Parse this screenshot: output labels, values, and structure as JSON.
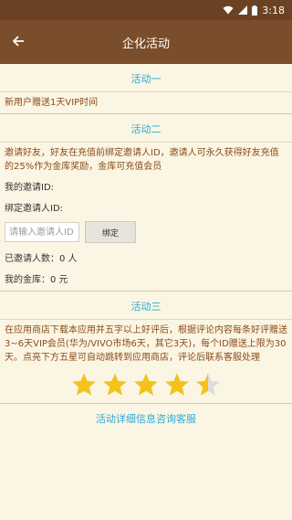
{
  "status_bar": {
    "time": "3:18"
  },
  "app_bar": {
    "title": "企化活动"
  },
  "section1": {
    "title": "活动一",
    "text": "新用户赠送1天VIP时间"
  },
  "section2": {
    "title": "活动二",
    "description": "邀请好友，好友在充值前绑定邀请人ID，邀请人可永久获得好友充值的25%作为金库奖励，金库可充值会员",
    "my_code_label": "我的邀请ID:",
    "bind_label": "绑定邀请人ID:",
    "input_placeholder": "请输入邀请人ID",
    "bind_button": "绑定",
    "invited_count": "已邀请人数：0 人",
    "vault": "我的金库：0 元"
  },
  "section3": {
    "title": "活动三",
    "description": "在应用商店下载本应用并五字以上好评后，根据评论内容每条好评赠送3~6天VIP会员(华为/VIVO市场6天，其它3天)，每个ID赠送上限为30天。点亮下方五星可自动跳转到应用商店，评论后联系客服处理",
    "rating": 4.5,
    "max_rating": 5
  },
  "footer": {
    "service_link": "活动详细信息咨询客服"
  },
  "colors": {
    "accent": "#2aa9d6",
    "brown_text": "#8b4a1b",
    "app_bar": "#7a4e2b",
    "star": "#f4c21b"
  }
}
